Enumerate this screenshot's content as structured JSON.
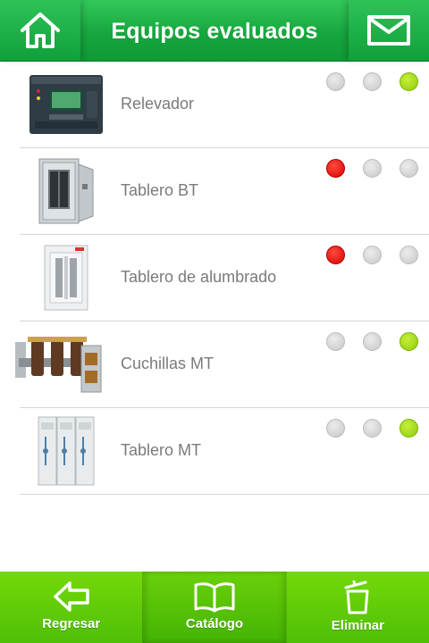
{
  "header": {
    "title": "Equipos evaluados",
    "home_icon": "home-icon",
    "mail_icon": "mail-icon"
  },
  "colors": {
    "header_green": "#16a63e",
    "footer_green": "#5ec808",
    "status_red": "#e00000",
    "status_green": "#a3d81a",
    "status_gray": "#d3d3d3"
  },
  "items": [
    {
      "name": "Relevador",
      "image": "relay-device",
      "status": [
        "gray",
        "gray",
        "green"
      ]
    },
    {
      "name": "Tablero BT",
      "image": "low-voltage-panel",
      "status": [
        "red",
        "gray",
        "gray"
      ]
    },
    {
      "name": "Tablero de alumbrado",
      "image": "lighting-panel",
      "status": [
        "red",
        "gray",
        "gray"
      ]
    },
    {
      "name": "Cuchillas MT",
      "image": "mv-disconnect-switch",
      "status": [
        "gray",
        "gray",
        "green"
      ]
    },
    {
      "name": "Tablero MT",
      "image": "mv-switchgear",
      "status": [
        "gray",
        "gray",
        "green"
      ]
    }
  ],
  "footer": {
    "back_label": "Regresar",
    "catalog_label": "Catálogo",
    "delete_label": "Eliminar"
  }
}
